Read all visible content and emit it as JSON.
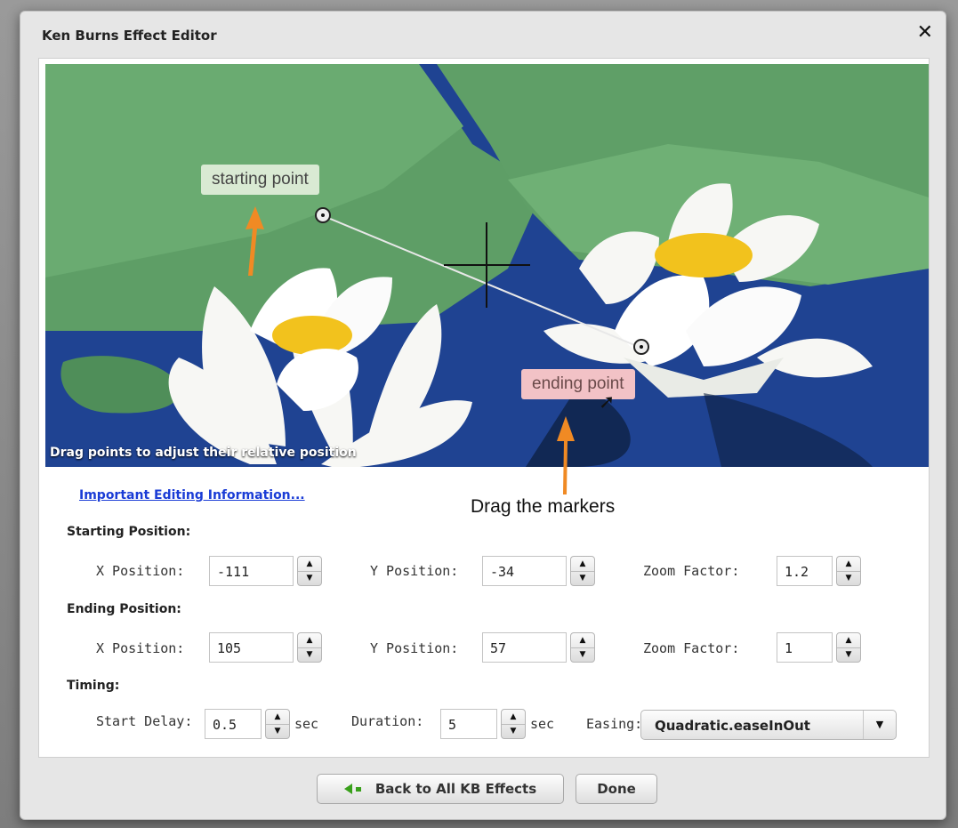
{
  "dialog": {
    "title": "Ken Burns Effect Editor",
    "close_symbol": "✕"
  },
  "stage": {
    "caption": "Drag points to adjust their relative position",
    "start_tag": "starting point",
    "end_tag": "ending point"
  },
  "info_link": "Important Editing Information...",
  "callout": "Drag the markers",
  "starting": {
    "heading": "Starting Position:",
    "x_label": "X Position:",
    "x_value": "-111",
    "y_label": "Y Position:",
    "y_value": "-34",
    "zoom_label": "Zoom Factor:",
    "zoom_value": "1.2"
  },
  "ending": {
    "heading": "Ending Position:",
    "x_label": "X Position:",
    "x_value": "105",
    "y_label": "Y Position:",
    "y_value": "57",
    "zoom_label": "Zoom Factor:",
    "zoom_value": "1"
  },
  "timing": {
    "heading": "Timing:",
    "delay_label": "Start Delay:",
    "delay_value": "0.5",
    "delay_unit": "sec",
    "duration_label": "Duration:",
    "duration_value": "5",
    "duration_unit": "sec",
    "easing_label": "Easing:",
    "easing_value": "Quadratic.easeInOut"
  },
  "footer": {
    "back_label": "Back to All KB Effects",
    "done_label": "Done"
  },
  "colors": {
    "link": "#1a3cd6",
    "arrow_accent": "#f08a24",
    "back_icon": "#39a01b"
  }
}
